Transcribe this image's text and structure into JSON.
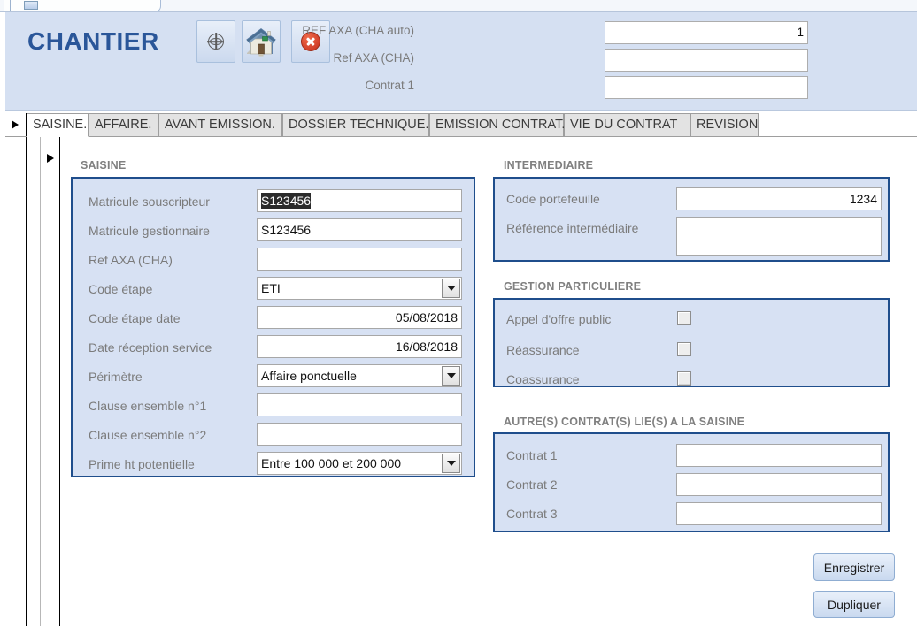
{
  "window": {
    "doc_tab_icon": "access-form-icon"
  },
  "header": {
    "title": "CHANTIER",
    "buttons": [
      {
        "name": "globe-button",
        "icon": "globe-icon"
      },
      {
        "name": "home-button",
        "icon": "house-icon"
      },
      {
        "name": "close-button",
        "icon": "close-circle-icon"
      }
    ],
    "fields": [
      {
        "label": "REF AXA (CHA auto)",
        "value": "1"
      },
      {
        "label": "Ref AXA (CHA)",
        "value": ""
      },
      {
        "label": "Contrat 1",
        "value": ""
      }
    ]
  },
  "tabs": [
    {
      "label": "SAISINE.",
      "active": true
    },
    {
      "label": "AFFAIRE.",
      "active": false
    },
    {
      "label": "AVANT EMISSION.",
      "active": false
    },
    {
      "label": "DOSSIER TECHNIQUE.",
      "active": false
    },
    {
      "label": "EMISSION CONTRAT.",
      "active": false
    },
    {
      "label": "VIE DU CONTRAT",
      "active": false
    },
    {
      "label": "REVISION",
      "active": false
    }
  ],
  "sections": {
    "saisine": {
      "title": "SAISINE",
      "fields": [
        {
          "label": "Matricule souscripteur",
          "value": "S123456",
          "type": "text",
          "selected": true
        },
        {
          "label": "Matricule gestionnaire",
          "value": "S123456",
          "type": "text",
          "selected": false
        },
        {
          "label": "Ref AXA (CHA)",
          "value": "",
          "type": "text",
          "selected": false
        },
        {
          "label": "Code étape",
          "value": "ETI",
          "type": "combo",
          "selected": false
        },
        {
          "label": "Code étape date",
          "value": "05/08/2018",
          "type": "text-right",
          "selected": false
        },
        {
          "label": "Date réception service",
          "value": "16/08/2018",
          "type": "text-right",
          "selected": false
        },
        {
          "label": "Périmètre",
          "value": "Affaire ponctuelle",
          "type": "combo",
          "selected": false
        },
        {
          "label": "Clause ensemble n°1",
          "value": "",
          "type": "text",
          "selected": false
        },
        {
          "label": "Clause ensemble n°2",
          "value": "",
          "type": "text",
          "selected": false
        },
        {
          "label": "Prime ht potentielle",
          "value": "Entre 100 000 et 200 000",
          "type": "combo",
          "selected": false
        }
      ]
    },
    "intermediaire": {
      "title": "INTERMEDIAIRE",
      "fields": [
        {
          "label": "Code portefeuille",
          "value": "1234",
          "type": "text-right"
        },
        {
          "label": "Référence intermédiaire",
          "value": "",
          "type": "textarea"
        }
      ]
    },
    "gestion": {
      "title": "GESTION PARTICULIERE",
      "checkboxes": [
        {
          "label": "Appel d'offre public",
          "checked": false
        },
        {
          "label": "Réassurance",
          "checked": false
        },
        {
          "label": "Coassurance",
          "checked": false
        }
      ]
    },
    "contrats": {
      "title": "AUTRE(S) CONTRAT(S) LIE(S) A LA SAISINE",
      "fields": [
        {
          "label": "Contrat 1",
          "value": ""
        },
        {
          "label": "Contrat 2",
          "value": ""
        },
        {
          "label": "Contrat 3",
          "value": ""
        }
      ]
    }
  },
  "actions": {
    "save_label": "Enregistrer",
    "duplicate_label": "Dupliquer"
  },
  "colors": {
    "header_band": "#d5e0f2",
    "title_blue": "#2a5699",
    "panel_fill": "#d7e1f3",
    "panel_border": "#1f4e8c",
    "label_gray": "#7b7b7b",
    "section_gray": "#808080",
    "close_red": "#d2402a"
  }
}
